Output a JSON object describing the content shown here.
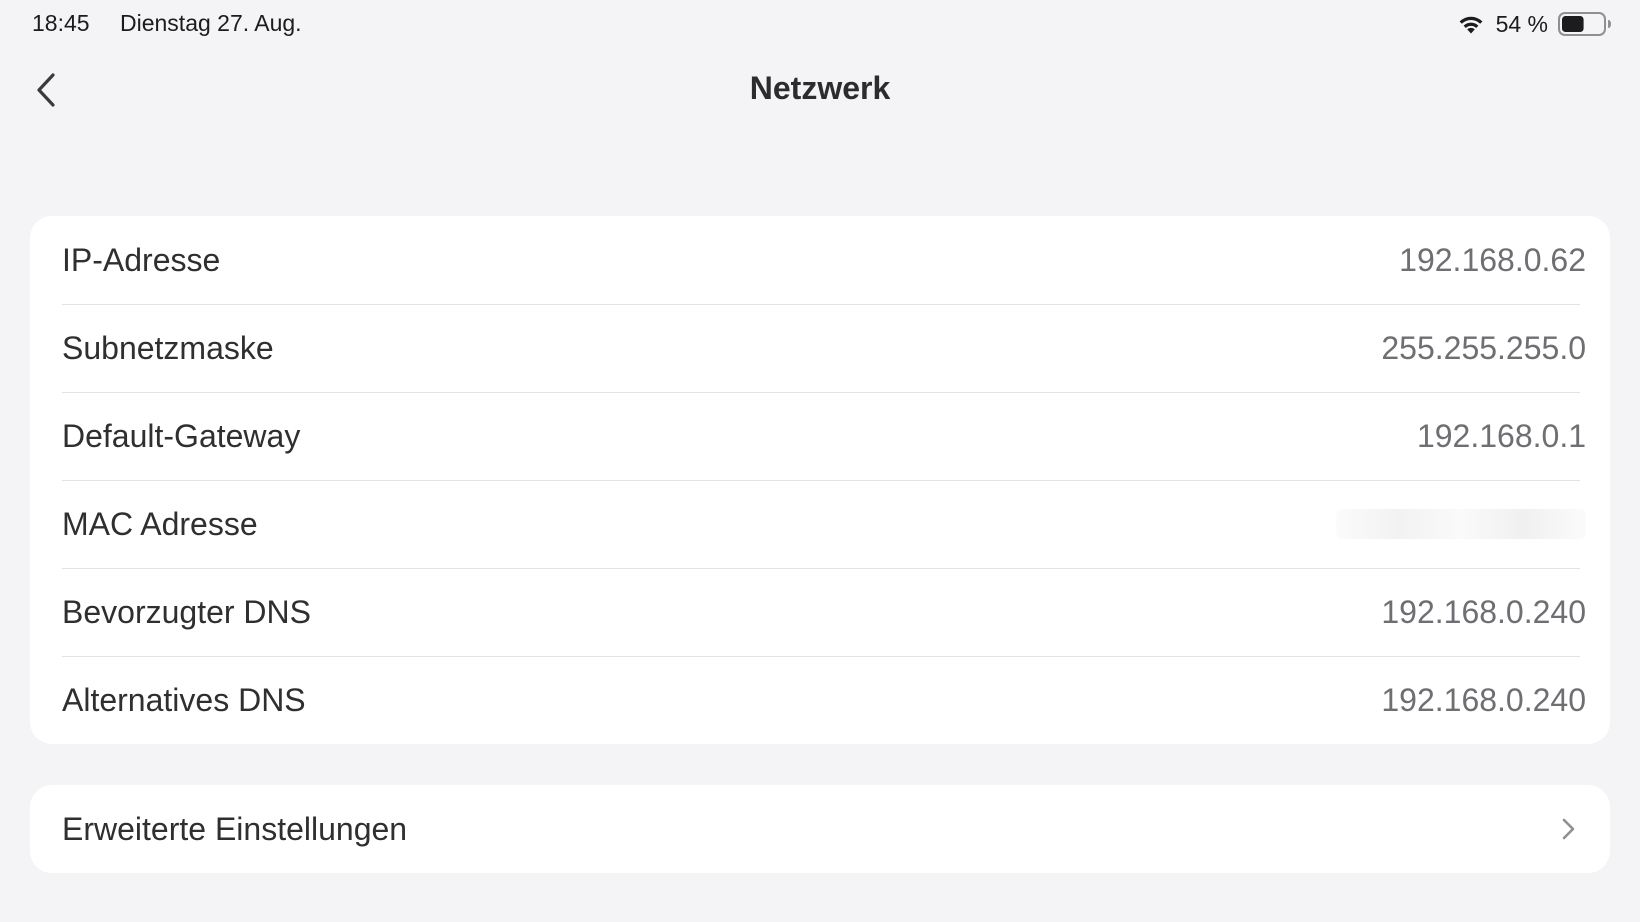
{
  "status_bar": {
    "time": "18:45",
    "date": "Dienstag 27. Aug.",
    "battery_percent": "54 %",
    "battery_level": 0.54,
    "wifi_icon": "wifi-icon",
    "battery_icon": "battery-icon"
  },
  "nav": {
    "back_icon": "chevron-left-icon",
    "title": "Netzwerk"
  },
  "network_info": {
    "rows": [
      {
        "label": "IP-Adresse",
        "value": "192.168.0.62"
      },
      {
        "label": "Subnetzmaske",
        "value": "255.255.255.0"
      },
      {
        "label": "Default-Gateway",
        "value": "192.168.0.1"
      },
      {
        "label": "MAC Adresse",
        "value": ""
      },
      {
        "label": "Bevorzugter DNS",
        "value": "192.168.0.240"
      },
      {
        "label": "Alternatives DNS",
        "value": "192.168.0.240"
      }
    ]
  },
  "advanced": {
    "label": "Erweiterte Einstellungen",
    "icon": "chevron-right-icon"
  },
  "colors": {
    "background": "#f4f4f6",
    "card": "#ffffff",
    "label": "#2f2f31",
    "value": "#6e6e73",
    "separator": "#e3e3e6"
  }
}
